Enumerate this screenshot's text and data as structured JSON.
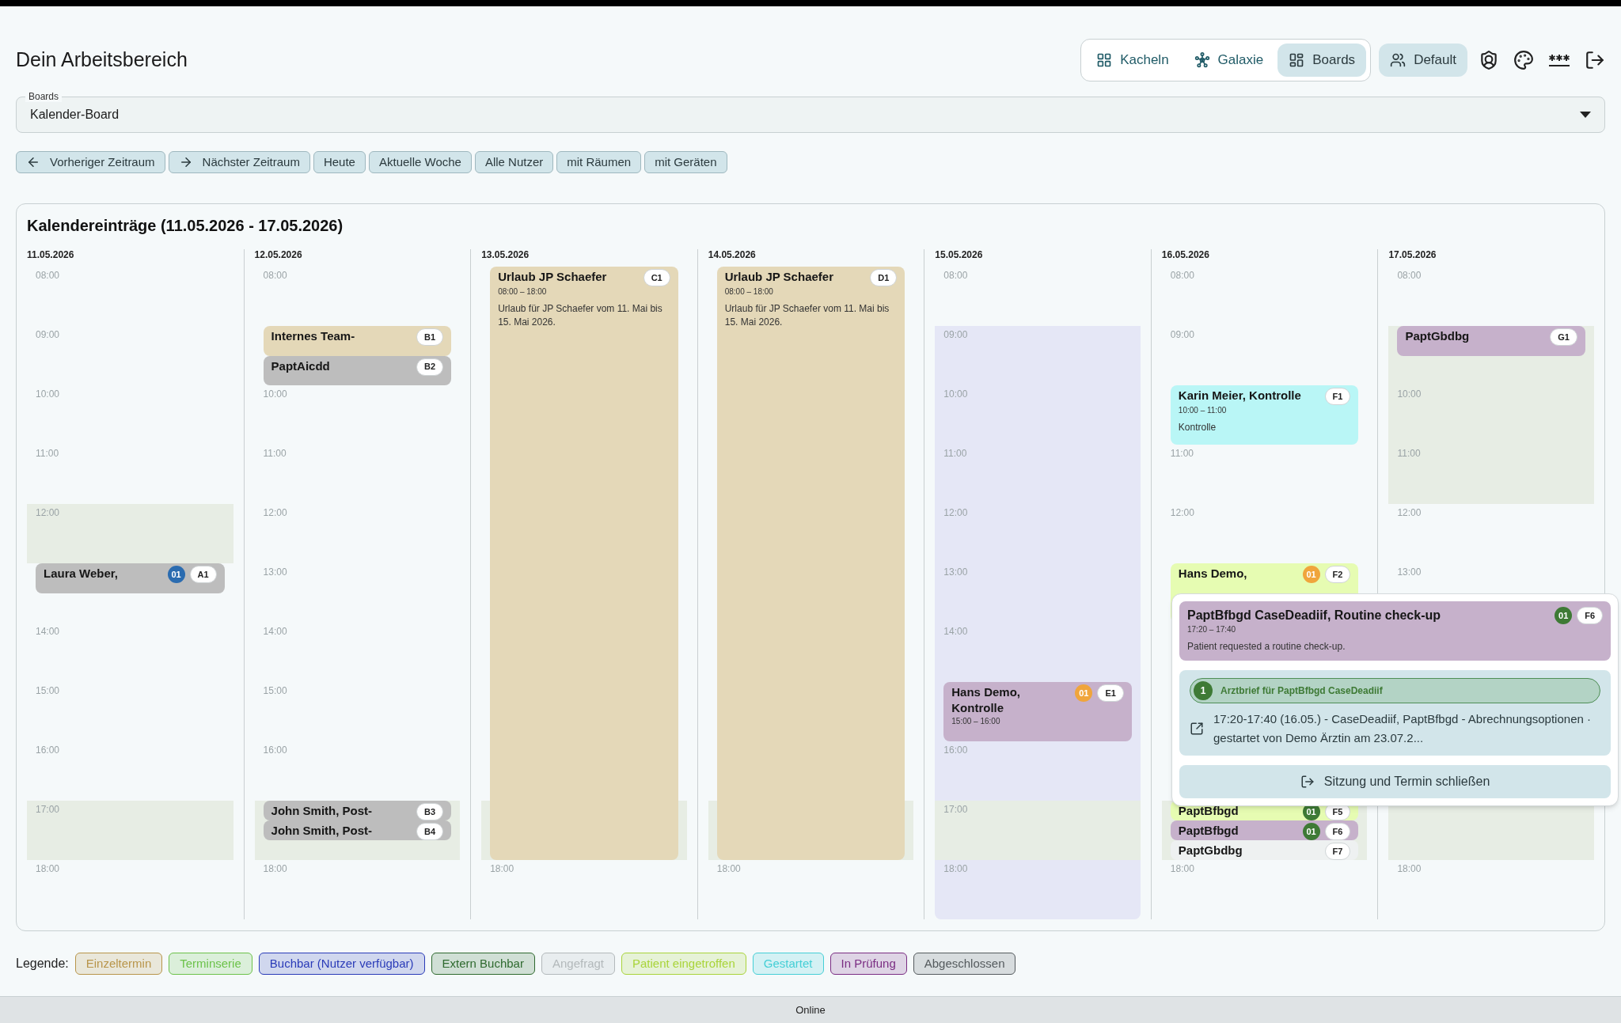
{
  "header": {
    "title": "Dein Arbeitsbereich",
    "view_tabs": [
      {
        "label": "Kacheln",
        "selected": false
      },
      {
        "label": "Galaxie",
        "selected": false
      },
      {
        "label": "Boards",
        "selected": true
      }
    ],
    "profile_button": "Default"
  },
  "boards_select": {
    "label": "Boards",
    "value": "Kalender-Board"
  },
  "toolbar": [
    "Vorheriger Zeitraum",
    "Nächster Zeitraum",
    "Heute",
    "Aktuelle Woche",
    "Alle Nutzer",
    "mit Räumen",
    "mit Geräten"
  ],
  "calendar": {
    "title": "Kalendereinträge (11.05.2026 - 17.05.2026)",
    "days": [
      {
        "date": "11.05.2026",
        "hours": [
          "08:00",
          "09:00",
          "10:00",
          "11:00",
          "12:00",
          "14:00",
          "15:00",
          "16:00",
          "17:00",
          "18:00"
        ],
        "blocks": [
          {
            "kind": "unavailable"
          },
          {
            "kind": "unavailable"
          }
        ],
        "events": [
          {
            "title": "Laura Weber,",
            "tag": "A1",
            "count": {
              "label": "01",
              "color": "#2b6cb0"
            },
            "color": "#bdbdbd"
          }
        ]
      },
      {
        "date": "12.05.2026",
        "hours": [
          "08:00",
          "10:00",
          "11:00",
          "12:00",
          "13:00",
          "14:00",
          "15:00",
          "16:00",
          "18:00"
        ],
        "blocks": [
          {
            "kind": "unavailable"
          }
        ],
        "events": [
          {
            "title": "Internes Team-",
            "tag": "B1",
            "color": "#e4d8b8"
          },
          {
            "title": "PaptAicdd",
            "tag": "B2",
            "color": "#bdbdbd"
          },
          {
            "title": "John Smith, Post-",
            "tag": "B3",
            "color": "#bdbdbd"
          },
          {
            "title": "John Smith, Post-",
            "tag": "B4",
            "color": "#bdbdbd"
          }
        ]
      },
      {
        "date": "13.05.2026",
        "hours": [
          "18:00"
        ],
        "blocks": [
          {
            "kind": "unavailable"
          }
        ],
        "events": [
          {
            "title": "Urlaub JP Schaefer",
            "tag": "C1",
            "color": "#e4d8b8",
            "time": "08:00 – 18:00",
            "note": "Urlaub für JP Schaefer vom 11. Mai bis 15. Mai 2026."
          }
        ]
      },
      {
        "date": "14.05.2026",
        "hours": [
          "18:00"
        ],
        "blocks": [
          {
            "kind": "unavailable"
          }
        ],
        "events": [
          {
            "title": "Urlaub JP Schaefer",
            "tag": "D1",
            "color": "#e4d8b8",
            "time": "08:00 – 18:00",
            "note": "Urlaub für JP Schaefer vom 11. Mai bis 15. Mai 2026."
          }
        ]
      },
      {
        "date": "15.05.2026",
        "hours": [
          "08:00",
          "09:00",
          "10:00",
          "11:00",
          "12:00",
          "13:00",
          "14:00",
          "16:00",
          "17:00",
          "18:00"
        ],
        "blocks": [
          {
            "kind": "bookable"
          },
          {
            "kind": "unavailable"
          }
        ],
        "events": [
          {
            "title": "Hans Demo, Kontrolle",
            "tag": "E1",
            "count": {
              "label": "01",
              "color": "#f0a53c"
            },
            "color": "#c6b1cb",
            "time": "15:00 – 16:00"
          }
        ]
      },
      {
        "date": "16.05.2026",
        "hours": [
          "08:00",
          "09:00",
          "11:00",
          "12:00",
          "18:00"
        ],
        "blocks": [
          {
            "kind": "unavailable"
          }
        ],
        "events": [
          {
            "title": "Karin Meier, Kontrolle",
            "tag": "F1",
            "color": "#b9f6f6",
            "time": "10:00 – 11:00",
            "note": "Kontrolle"
          },
          {
            "title": "Hans Demo,",
            "tag": "F2",
            "count": {
              "label": "01",
              "color": "#f0a53c"
            },
            "color": "#e6fcb2"
          },
          {
            "title": "PaptBfbgd",
            "tag": "F5",
            "count": {
              "label": "01",
              "color": "#3e7a35"
            },
            "color": "#e6fcb2"
          },
          {
            "title": "PaptBfbgd",
            "tag": "F6",
            "count": {
              "label": "01",
              "color": "#3e7a35"
            },
            "color": "#c6b1cb"
          },
          {
            "title": "PaptGbdbg",
            "tag": "F7",
            "color": "#eef1f1"
          }
        ]
      },
      {
        "date": "17.05.2026",
        "hours": [
          "08:00",
          "10:00",
          "11:00",
          "12:00",
          "13:00",
          "18:00"
        ],
        "blocks": [
          {
            "kind": "unavailable"
          },
          {
            "kind": "unavailable"
          }
        ],
        "events": [
          {
            "title": "PaptGbdbg",
            "tag": "G1",
            "color": "#c6b1cb"
          }
        ]
      }
    ]
  },
  "popover": {
    "event": {
      "title": "PaptBfbgd CaseDeadiif, Routine check-up",
      "time": "17:20 – 17:40",
      "note": "Patient requested a routine check-up.",
      "count": {
        "label": "01",
        "color": "#3e7a35"
      },
      "tag": "F6",
      "color": "#c6b1cb"
    },
    "document": {
      "number": "1",
      "title": "Arztbrief für PaptBfbgd CaseDeadiif",
      "description": "17:20-17:40 (16.05.) - CaseDeadiif, PaptBfbgd - Abrechnungsoptionen · gestartet von Demo Ärztin am 23.07.2..."
    },
    "close_button": "Sitzung und Termin schließen"
  },
  "legend": {
    "label": "Legende:",
    "items": [
      {
        "label": "Einzeltermin",
        "color": "#b8954a"
      },
      {
        "label": "Terminserie",
        "color": "#6cc24a"
      },
      {
        "label": "Buchbar (Nutzer verfügbar)",
        "color": "#2a3bb8"
      },
      {
        "label": "Extern Buchbar",
        "color": "#2f6a2f"
      },
      {
        "label": "Angefragt",
        "color": "#b3b9bb"
      },
      {
        "label": "Patient eingetroffen",
        "color": "#a9d43a"
      },
      {
        "label": "Gestartet",
        "color": "#45cfd6"
      },
      {
        "label": "In Prüfung",
        "color": "#7b2d83"
      },
      {
        "label": "Abgeschlossen",
        "color": "#555b5e"
      }
    ]
  },
  "status_bar": "Online"
}
